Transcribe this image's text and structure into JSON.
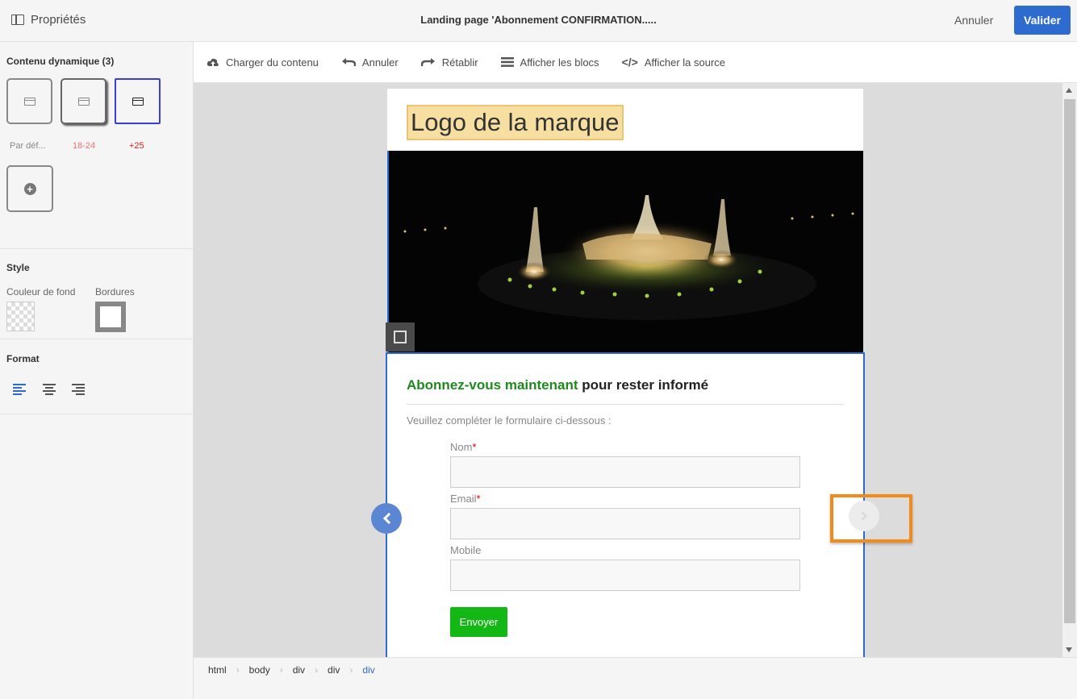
{
  "header": {
    "properties_label": "Propriétés",
    "title": "Landing page 'Abonnement CONFIRMATION.....",
    "cancel_label": "Annuler",
    "validate_label": "Valider"
  },
  "sidebar": {
    "dynamic_content_title": "Contenu dynamique (3)",
    "variants": [
      {
        "label": "Par déf...",
        "color": "#888888"
      },
      {
        "label": "18-24",
        "color": "#f07070"
      },
      {
        "label": "+25",
        "color": "#dd2222"
      }
    ],
    "style_title": "Style",
    "bg_color_label": "Couleur de fond",
    "borders_label": "Bordures",
    "format_title": "Format"
  },
  "toolbar": {
    "load_content": "Charger du contenu",
    "undo": "Annuler",
    "redo": "Rétablir",
    "show_blocks": "Afficher les blocs",
    "show_source": "Afficher la source"
  },
  "page": {
    "logo_text": "Logo de la marque",
    "form_title_highlight": "Abonnez-vous maintenant",
    "form_title_rest": " pour rester informé",
    "form_intro": "Veuillez compléter le formulaire ci-dessous :",
    "fields": [
      {
        "label": "Nom",
        "required_mark": "*"
      },
      {
        "label": "Email",
        "required_mark": "*"
      },
      {
        "label": "Mobile",
        "required_mark": ""
      }
    ],
    "submit_label": "Envoyer"
  },
  "breadcrumb": [
    "html",
    "body",
    "div",
    "div",
    "div"
  ],
  "colors": {
    "accent": "#2d6cce",
    "submit": "#14b814",
    "highlight": "#f28b1a"
  }
}
